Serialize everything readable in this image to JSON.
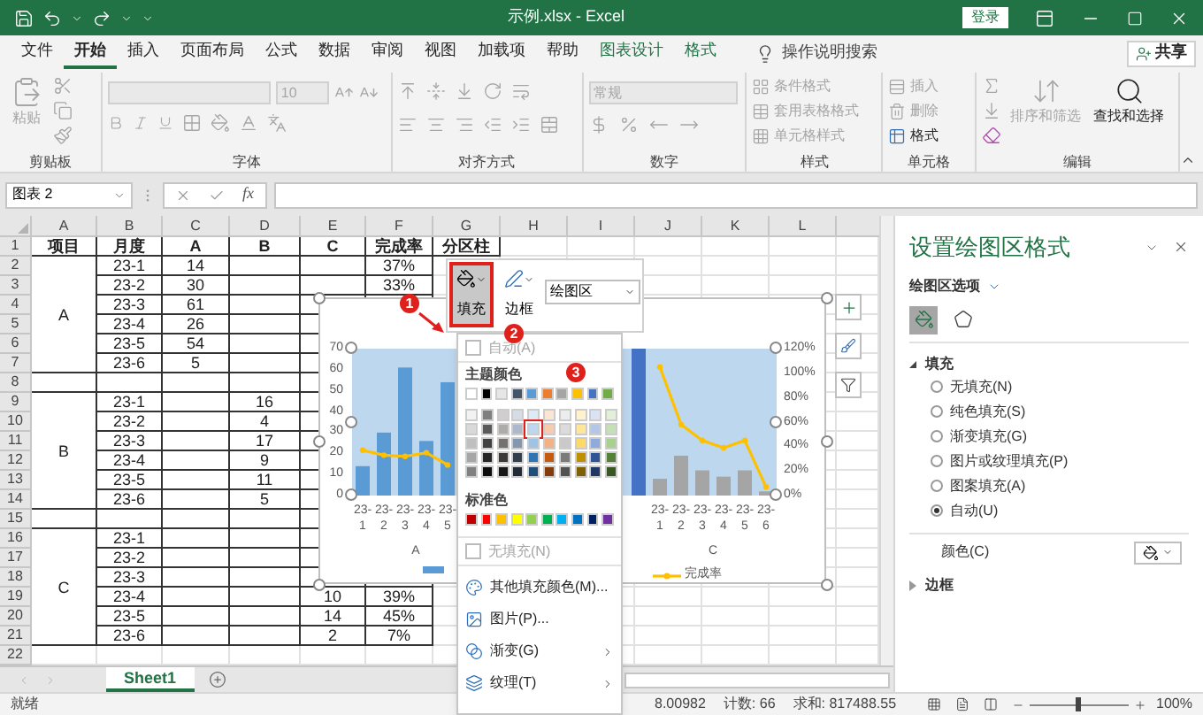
{
  "window": {
    "title": "示例.xlsx - Excel",
    "login": "登录"
  },
  "ribbon_tabs": [
    {
      "label": "文件",
      "selected": false,
      "kind": "normal"
    },
    {
      "label": "开始",
      "selected": true,
      "kind": "normal"
    },
    {
      "label": "插入",
      "selected": false,
      "kind": "normal"
    },
    {
      "label": "页面布局",
      "selected": false,
      "kind": "normal"
    },
    {
      "label": "公式",
      "selected": false,
      "kind": "normal"
    },
    {
      "label": "数据",
      "selected": false,
      "kind": "normal"
    },
    {
      "label": "审阅",
      "selected": false,
      "kind": "normal"
    },
    {
      "label": "视图",
      "selected": false,
      "kind": "normal"
    },
    {
      "label": "加载项",
      "selected": false,
      "kind": "normal"
    },
    {
      "label": "帮助",
      "selected": false,
      "kind": "normal"
    },
    {
      "label": "图表设计",
      "selected": false,
      "kind": "contextual"
    },
    {
      "label": "格式",
      "selected": false,
      "kind": "contextual"
    }
  ],
  "search": {
    "placeholder": "操作说明搜索"
  },
  "share": "共享",
  "ribbon": {
    "clipboard": {
      "label": "剪贴板",
      "paste": {
        "label": "粘贴",
        "disabled": true
      }
    },
    "font": {
      "label": "字体",
      "size": "10"
    },
    "alignment": {
      "label": "对齐方式"
    },
    "number": {
      "label": "数字",
      "format": "常规"
    },
    "styles": {
      "label": "样式",
      "items": [
        {
          "label": "条件格式",
          "disabled": true
        },
        {
          "label": "套用表格格式",
          "disabled": true
        },
        {
          "label": "单元格样式",
          "disabled": true
        }
      ]
    },
    "cells": {
      "label": "单元格",
      "items": [
        {
          "label": "插入",
          "disabled": true
        },
        {
          "label": "删除",
          "disabled": true
        },
        {
          "label": "格式",
          "disabled": false
        }
      ]
    },
    "editing": {
      "label": "编辑",
      "sort": {
        "label": "排序和筛选",
        "disabled": true
      },
      "find": {
        "label": "查找和选择",
        "disabled": false
      }
    }
  },
  "formula_bar": {
    "name_box": "图表 2",
    "function_label": "fx"
  },
  "sheet": {
    "column_headers": [
      "A",
      "B",
      "C",
      "D",
      "E",
      "F",
      "G",
      "H",
      "I",
      "J",
      "K",
      "L"
    ],
    "row_headers": [
      "1",
      "2",
      "3",
      "4",
      "5",
      "6",
      "7",
      "8",
      "9",
      "10",
      "11",
      "12",
      "13",
      "14",
      "15",
      "16",
      "17",
      "18",
      "19",
      "20",
      "21",
      "22"
    ],
    "header_row": [
      "项目",
      "月度",
      "A",
      "B",
      "C",
      "完成率",
      "分区柱"
    ],
    "sections": [
      {
        "label": "A",
        "rows": [
          [
            "23-1",
            "14",
            null,
            null,
            "37%"
          ],
          [
            "23-2",
            "30",
            null,
            null,
            "33%"
          ],
          [
            "23-3",
            "61",
            null,
            null,
            null
          ],
          [
            "23-4",
            "26",
            null,
            null,
            null
          ],
          [
            "23-5",
            "54",
            null,
            null,
            null
          ],
          [
            "23-6",
            "5",
            null,
            null,
            null
          ]
        ]
      },
      {
        "label": "B",
        "rows": [
          [
            "23-1",
            null,
            "16",
            null,
            null
          ],
          [
            "23-2",
            null,
            "4",
            null,
            null
          ],
          [
            "23-3",
            null,
            "17",
            null,
            null
          ],
          [
            "23-4",
            null,
            "9",
            null,
            null
          ],
          [
            "23-5",
            null,
            "11",
            null,
            null
          ],
          [
            "23-6",
            null,
            "5",
            null,
            null
          ]
        ]
      },
      {
        "label": "C",
        "rows": [
          [
            "23-1",
            null,
            null,
            null,
            null
          ],
          [
            "23-2",
            null,
            null,
            null,
            null
          ],
          [
            "23-3",
            null,
            null,
            null,
            null
          ],
          [
            "23-4",
            null,
            null,
            "10",
            "39%"
          ],
          [
            "23-5",
            null,
            null,
            "14",
            "45%"
          ],
          [
            "23-6",
            null,
            null,
            "2",
            "7%"
          ]
        ]
      }
    ]
  },
  "chart": {
    "chart_data": {
      "type": "bar",
      "categories": [
        "23-1",
        "23-2",
        "23-3",
        "23-4",
        "23-5",
        null,
        null,
        null,
        null,
        null,
        null,
        null,
        null,
        null,
        "23-1",
        "23-2",
        "23-3",
        "23-4",
        "23-5",
        "23-6"
      ],
      "series": [
        {
          "color": "#5b9bd5",
          "values": [
            14,
            30,
            61,
            26,
            54,
            null,
            null,
            null,
            null,
            null,
            null,
            null,
            null,
            null,
            null,
            null,
            null,
            null,
            null,
            null
          ]
        },
        {
          "color": "#4472c4",
          "values": [
            null,
            null,
            null,
            null,
            null,
            null,
            null,
            null,
            null,
            null,
            null,
            null,
            null,
            70,
            null,
            null,
            null,
            null,
            null,
            null
          ]
        },
        {
          "color": "#a5a5a5",
          "values": [
            null,
            null,
            null,
            null,
            null,
            null,
            null,
            null,
            null,
            null,
            null,
            null,
            null,
            null,
            8,
            19,
            12,
            9,
            12,
            2
          ]
        },
        {
          "type": "line",
          "axis": "y2",
          "marker": "o",
          "color": "#ffc000",
          "values": [
            37,
            33,
            32,
            35,
            25,
            null,
            null,
            null,
            null,
            null,
            null,
            null,
            null,
            null,
            105,
            58,
            45,
            39,
            45,
            7
          ]
        }
      ],
      "ylim": [
        0,
        70
      ],
      "yticks": [
        0,
        10,
        20,
        30,
        40,
        50,
        60,
        70
      ],
      "y2lim": [
        0,
        120
      ],
      "y2ticks": [
        {
          "value": 120,
          "label": "120%"
        },
        {
          "value": 100,
          "label": "100%"
        },
        {
          "value": 80,
          "label": "80%"
        },
        {
          "value": 60,
          "label": "60%"
        },
        {
          "value": 40,
          "label": "40%"
        },
        {
          "value": 20,
          "label": "20%"
        },
        {
          "value": 0,
          "label": "0%"
        }
      ]
    },
    "group_labels": [
      "A",
      "C"
    ],
    "legend": [
      {
        "kind": "bar",
        "color": "#5b9bd5"
      },
      {
        "kind": "line",
        "color": "#ffc000",
        "label": "完成率"
      }
    ]
  },
  "chart_toolbar": {
    "fill": {
      "label": "填充",
      "selected": true
    },
    "border": {
      "label": "边框",
      "selected": false
    },
    "element": "绘图区"
  },
  "fill_menu": {
    "auto": {
      "label": "自动(A)",
      "checked": false
    },
    "theme_label": "主题颜色",
    "theme_colors": [
      {
        "color": "#ffffff",
        "selected": false,
        "shades": [
          {
            "color": "#f2f2f2",
            "selected": false
          },
          {
            "color": "#d9d9d9",
            "selected": false
          },
          {
            "color": "#bfbfbf",
            "selected": false
          },
          {
            "color": "#a6a6a6",
            "selected": false
          },
          {
            "color": "#808080",
            "selected": false
          }
        ]
      },
      {
        "color": "#000000",
        "selected": false,
        "shades": [
          {
            "color": "#7f7f7f",
            "selected": false
          },
          {
            "color": "#595959",
            "selected": false
          },
          {
            "color": "#404040",
            "selected": false
          },
          {
            "color": "#262626",
            "selected": false
          },
          {
            "color": "#0d0d0d",
            "selected": false
          }
        ]
      },
      {
        "color": "#e7e6e6",
        "selected": false,
        "shades": [
          {
            "color": "#d0cece",
            "selected": false
          },
          {
            "color": "#aeabab",
            "selected": false
          },
          {
            "color": "#767171",
            "selected": false
          },
          {
            "color": "#3b3838",
            "selected": false
          },
          {
            "color": "#181717",
            "selected": false
          }
        ]
      },
      {
        "color": "#44546a",
        "selected": false,
        "shades": [
          {
            "color": "#d6dce4",
            "selected": false
          },
          {
            "color": "#adb9ca",
            "selected": false
          },
          {
            "color": "#8497b0",
            "selected": false
          },
          {
            "color": "#333f4f",
            "selected": false
          },
          {
            "color": "#222a35",
            "selected": false
          }
        ]
      },
      {
        "color": "#5b9bd5",
        "selected": false,
        "shades": [
          {
            "color": "#deebf6",
            "selected": false
          },
          {
            "color": "#bdd7ee",
            "selected": true
          },
          {
            "color": "#9dc3e6",
            "selected": false
          },
          {
            "color": "#2e75b5",
            "selected": false
          },
          {
            "color": "#1f4e79",
            "selected": false
          }
        ]
      },
      {
        "color": "#ed7d31",
        "selected": false,
        "shades": [
          {
            "color": "#fbe5d5",
            "selected": false
          },
          {
            "color": "#f7cbac",
            "selected": false
          },
          {
            "color": "#f4b183",
            "selected": false
          },
          {
            "color": "#c55a11",
            "selected": false
          },
          {
            "color": "#843c0b",
            "selected": false
          }
        ]
      },
      {
        "color": "#a5a5a5",
        "selected": false,
        "shades": [
          {
            "color": "#ededed",
            "selected": false
          },
          {
            "color": "#dbdbdb",
            "selected": false
          },
          {
            "color": "#c9c9c9",
            "selected": false
          },
          {
            "color": "#7b7b7b",
            "selected": false
          },
          {
            "color": "#525252",
            "selected": false
          }
        ]
      },
      {
        "color": "#ffc000",
        "selected": false,
        "shades": [
          {
            "color": "#fff2cc",
            "selected": false
          },
          {
            "color": "#ffe699",
            "selected": false
          },
          {
            "color": "#ffd966",
            "selected": false
          },
          {
            "color": "#bf9000",
            "selected": false
          },
          {
            "color": "#7f6000",
            "selected": false
          }
        ]
      },
      {
        "color": "#4472c4",
        "selected": false,
        "shades": [
          {
            "color": "#dae3f3",
            "selected": false
          },
          {
            "color": "#b4c7e7",
            "selected": false
          },
          {
            "color": "#8faadc",
            "selected": false
          },
          {
            "color": "#2f5597",
            "selected": false
          },
          {
            "color": "#203864",
            "selected": false
          }
        ]
      },
      {
        "color": "#70ad47",
        "selected": false,
        "shades": [
          {
            "color": "#e2f0d9",
            "selected": false
          },
          {
            "color": "#c5e0b4",
            "selected": false
          },
          {
            "color": "#a9d18e",
            "selected": false
          },
          {
            "color": "#538135",
            "selected": false
          },
          {
            "color": "#385723",
            "selected": false
          }
        ]
      }
    ],
    "standard_label": "标准色",
    "standard_colors": [
      {
        "color": "#c00000",
        "selected": false
      },
      {
        "color": "#ff0000",
        "selected": false
      },
      {
        "color": "#ffc000",
        "selected": false
      },
      {
        "color": "#ffff00",
        "selected": false
      },
      {
        "color": "#92d050",
        "selected": false
      },
      {
        "color": "#00b050",
        "selected": false
      },
      {
        "color": "#00b0f0",
        "selected": false
      },
      {
        "color": "#0070c0",
        "selected": false
      },
      {
        "color": "#002060",
        "selected": false
      },
      {
        "color": "#7030a0",
        "selected": false
      }
    ],
    "no_fill": {
      "label": "无填充(N)",
      "checked": false
    },
    "items": [
      {
        "label": "其他填充颜色(M)...",
        "kind": "colors",
        "submenu": false
      },
      {
        "label": "图片(P)...",
        "kind": "picture",
        "submenu": false
      },
      {
        "label": "渐变(G)",
        "kind": "gradient",
        "submenu": true
      },
      {
        "label": "纹理(T)",
        "kind": "texture",
        "submenu": true
      }
    ]
  },
  "annotations": [
    {
      "number": "1"
    },
    {
      "number": "2"
    },
    {
      "number": "3"
    }
  ],
  "format_pane": {
    "title": "设置绘图区格式",
    "options_label": "绘图区选项",
    "icon_tabs": [
      {
        "kind": "fill",
        "selected": true
      },
      {
        "kind": "shape",
        "selected": false
      }
    ],
    "sections": [
      {
        "label": "填充",
        "expanded": true,
        "options": [
          {
            "label": "无填充(N)",
            "selected": false
          },
          {
            "label": "纯色填充(S)",
            "selected": false
          },
          {
            "label": "渐变填充(G)",
            "selected": false
          },
          {
            "label": "图片或纹理填充(P)",
            "selected": false
          },
          {
            "label": "图案填充(A)",
            "selected": false
          },
          {
            "label": "自动(U)",
            "selected": true
          }
        ],
        "color_label": "颜色(C)"
      },
      {
        "label": "边框",
        "expanded": false
      }
    ]
  },
  "sheet_tabs": [
    {
      "label": "Sheet1",
      "selected": true
    }
  ],
  "status_bar": {
    "ready": "就绪",
    "average": "8.00982",
    "count": "计数: 66",
    "sum": "求和: 817488.55",
    "zoom": "100%",
    "zoom_slider": {
      "level": 0.5
    }
  }
}
